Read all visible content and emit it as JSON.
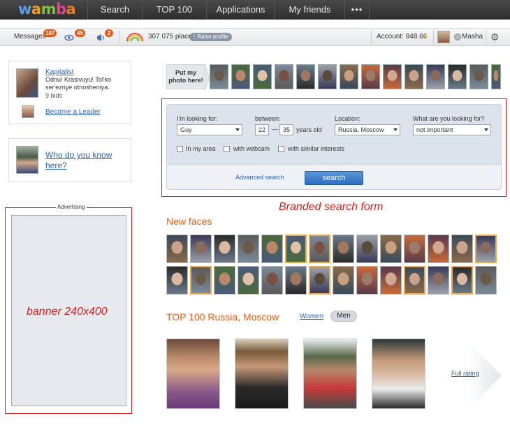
{
  "logo": {
    "w": "w",
    "a": "a",
    "m": "m",
    "b": "b",
    "a2": "a"
  },
  "nav": {
    "search": "Search",
    "top100": "TOP 100",
    "apps": "Applications",
    "friends": "My friends",
    "more": "•••"
  },
  "subbar": {
    "messages_label": "Messages",
    "messages_count": "107",
    "views_count": "45",
    "notifications_count": "2",
    "place": "307 075 place",
    "raise_label": "Raise profile",
    "account_label": "Account: 948.66",
    "username": "Masha"
  },
  "leader_box": {
    "name": "Kapitalist",
    "text": "Odnu! Krasivuyu! Tol'ko ser'eznye otnosheniya.",
    "bids": "9 bids",
    "become_link": "Become a Leader"
  },
  "who_box": {
    "text": "Who do you know here?"
  },
  "advertising": {
    "label": "Advertising",
    "banner_text": "banner 240x400"
  },
  "photo_strip": {
    "put_photo": "Put my photo here!"
  },
  "search_form": {
    "looking_label": "I'm looking for:",
    "looking_value": "Guy",
    "between_label": "between:",
    "age_from": "22",
    "age_dash": "—",
    "age_to": "35",
    "years_old": "years old",
    "location_label": "Location:",
    "location_value": "Russia, Moscow",
    "purpose_label": "What are you looking for?",
    "purpose_value": "not important",
    "cb_area": "In my area",
    "cb_webcam": "with webcam",
    "cb_interests": "with similar interests",
    "advanced_link": "Advanced search",
    "search_button": "search"
  },
  "annotation": {
    "branded": "Branded search form"
  },
  "new_faces": {
    "title": "New faces"
  },
  "top100": {
    "title": "TOP 100 Russia, Moscow",
    "women": "Women",
    "men": "Men",
    "full_rating": "Full rating"
  }
}
